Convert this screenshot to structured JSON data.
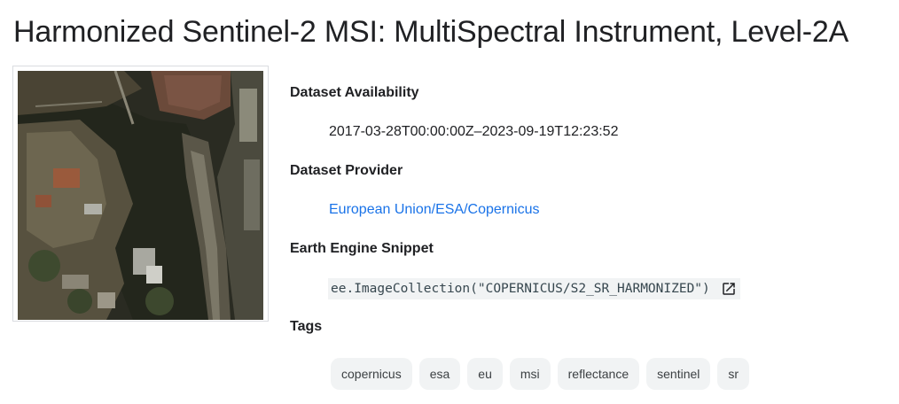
{
  "title": "Harmonized Sentinel-2 MSI: MultiSpectral Instrument, Level-2A",
  "thumbnail": {
    "description_icon": "satellite-thumbnail"
  },
  "availability": {
    "label": "Dataset Availability",
    "value": "2017-03-28T00:00:00Z–2023-09-19T12:23:52"
  },
  "provider": {
    "label": "Dataset Provider",
    "value": "European Union/ESA/Copernicus"
  },
  "snippet": {
    "label": "Earth Engine Snippet",
    "code": "ee.ImageCollection(\"COPERNICUS/S2_SR_HARMONIZED\")",
    "icon": "open-in-new-icon"
  },
  "tags": {
    "label": "Tags",
    "items": [
      "copernicus",
      "esa",
      "eu",
      "msi",
      "reflectance",
      "sentinel",
      "sr"
    ]
  },
  "colors": {
    "link": "#1a73e8",
    "chip_bg": "#f1f3f4",
    "code_bg": "#f1f3f4"
  }
}
